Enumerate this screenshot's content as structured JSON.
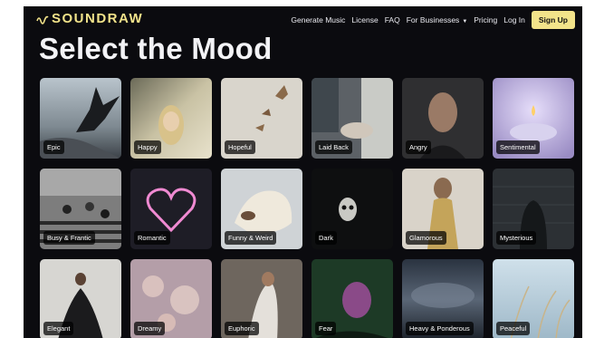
{
  "brand": {
    "name": "SOUNDRAW",
    "logo_icon": "wave-logo-icon"
  },
  "nav": {
    "links": [
      "Generate Music",
      "License",
      "FAQ",
      "For Businesses",
      "Pricing",
      "Log In"
    ],
    "dropdown_icon": "caret-down-icon",
    "signup_label": "Sign Up"
  },
  "page": {
    "title": "Select the Mood"
  },
  "colors": {
    "background": "#0b0b0f",
    "accent": "#f2e38a",
    "text": "#f3f3f6"
  },
  "moods": [
    {
      "label": "Epic"
    },
    {
      "label": "Happy"
    },
    {
      "label": "Hopeful"
    },
    {
      "label": "Laid Back"
    },
    {
      "label": "Angry"
    },
    {
      "label": "Sentimental"
    },
    {
      "label": "Busy & Frantic"
    },
    {
      "label": "Romantic"
    },
    {
      "label": "Funny & Weird"
    },
    {
      "label": "Dark"
    },
    {
      "label": "Glamorous"
    },
    {
      "label": "Mysterious"
    },
    {
      "label": "Elegant"
    },
    {
      "label": "Dreamy"
    },
    {
      "label": "Euphoric"
    },
    {
      "label": "Fear"
    },
    {
      "label": "Heavy & Ponderous"
    },
    {
      "label": "Peaceful"
    }
  ]
}
